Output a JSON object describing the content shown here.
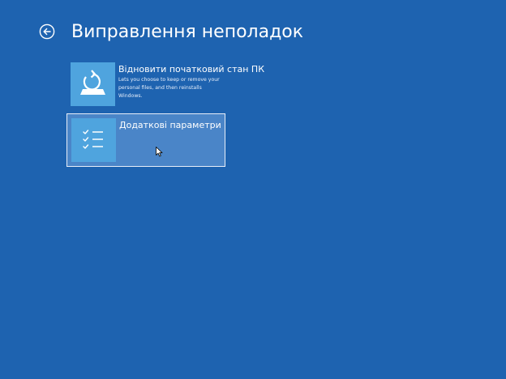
{
  "header": {
    "title": "Виправлення неполадок",
    "back_icon": "arrow-left-circle-icon"
  },
  "options": [
    {
      "title": "Відновити початковий стан ПК",
      "description": "Lets you choose to keep or remove your personal files, and then reinstalls Windows.",
      "icon": "reset-pc-icon"
    },
    {
      "title": "Додаткові параметри",
      "icon": "checklist-icon"
    }
  ],
  "colors": {
    "background": "#1e63b0",
    "tile": "#4fa4de",
    "selected_bg": "#4a85c8"
  }
}
